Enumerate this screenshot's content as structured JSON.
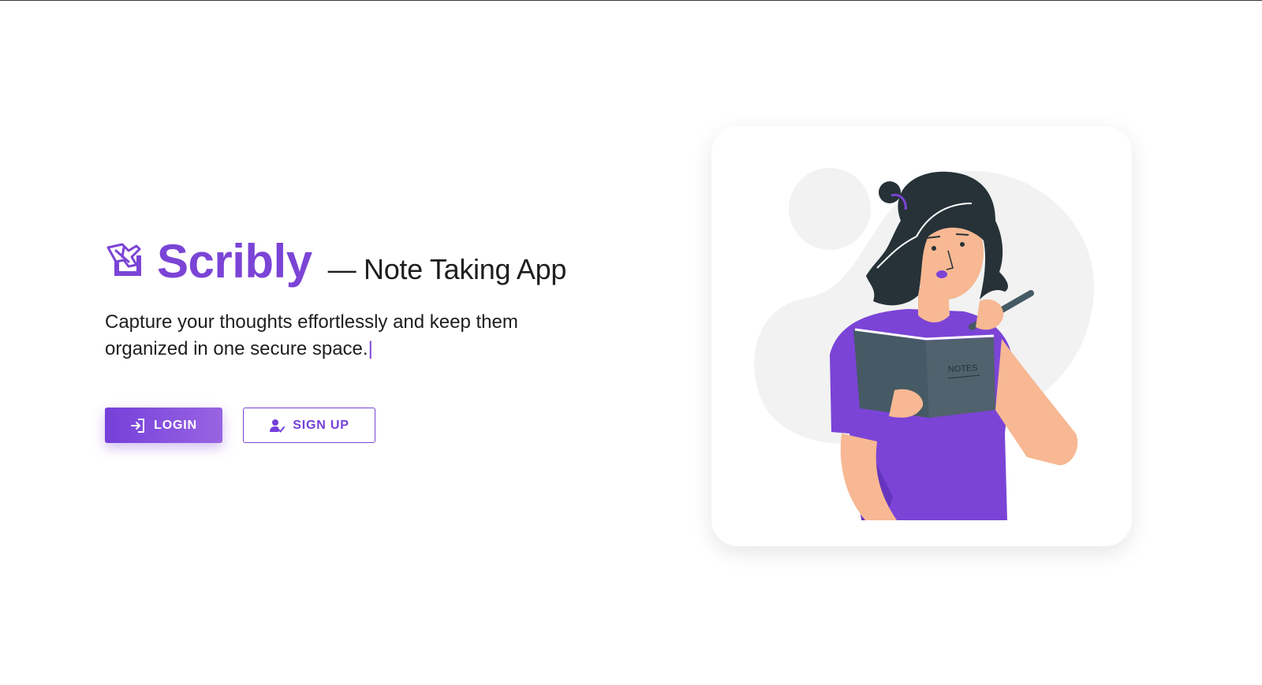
{
  "app": {
    "name": "Scribly",
    "tagline": "— Note Taking App",
    "description": "Capture your thoughts effortlessly and keep them organized in one secure space.",
    "caret": "|",
    "accent_color": "#7b44d6"
  },
  "actions": {
    "login_label": "LOGIN",
    "login_icon": "login-icon",
    "signup_label": "SIGN UP",
    "signup_icon": "user-check-icon"
  },
  "illustration": {
    "notebook_label": "NOTES"
  }
}
